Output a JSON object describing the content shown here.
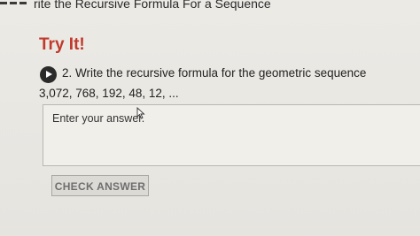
{
  "header": {
    "lesson_title": "rite the Recursive Formula For a Sequence"
  },
  "section": {
    "heading": "Try It!"
  },
  "question": {
    "text": "2. Write the recursive formula for the geometric sequence",
    "sequence": "3,072,  768,  192,  48,  12,  ..."
  },
  "answer": {
    "placeholder": "Enter your answer."
  },
  "actions": {
    "check_label": "CHECK ANSWER"
  }
}
